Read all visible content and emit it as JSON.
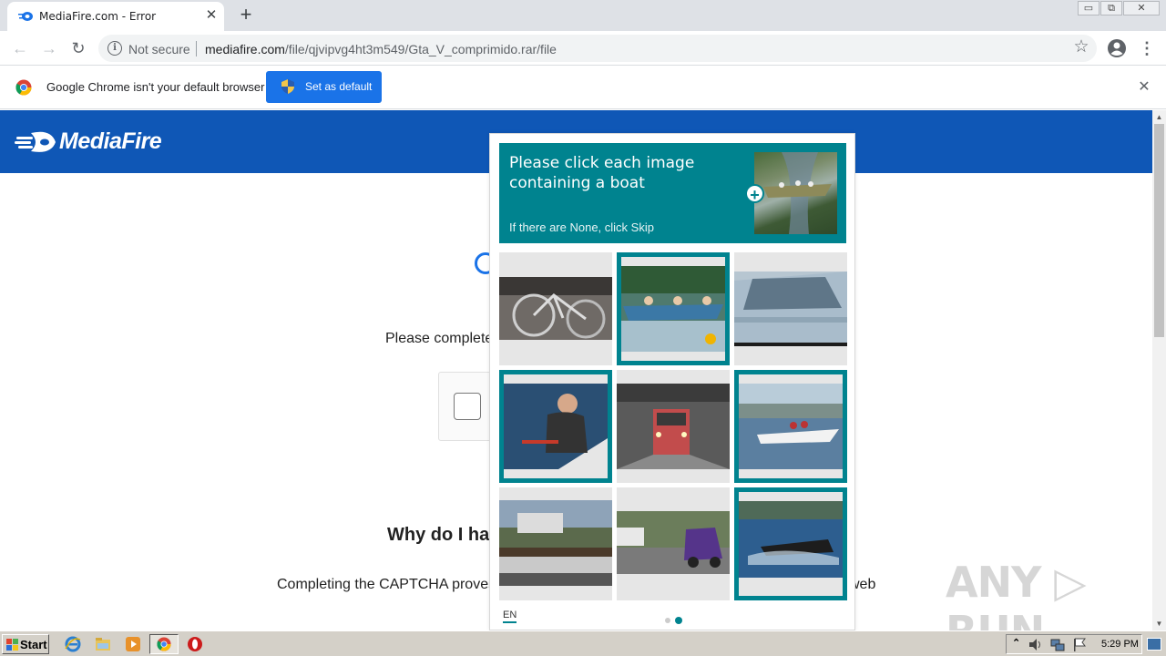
{
  "browser": {
    "tab_title": "MediaFire.com - Error",
    "tab_close": "✕",
    "new_tab": "+",
    "window_controls": {
      "minimize": "▭",
      "restore": "⧉",
      "close": "✕"
    },
    "nav": {
      "back": "←",
      "forward": "→",
      "reload": "↻",
      "menu": "⋮"
    },
    "omnibox": {
      "security_label": "Not secure",
      "url_domain": "mediafire.com",
      "url_path": "/file/qjvipvg4ht3m549/Gta_V_comprimido.rar/file",
      "star": "☆"
    }
  },
  "infobar": {
    "text": "Google Chrome isn't your default browser",
    "button_label": "Set as default",
    "close": "✕"
  },
  "page": {
    "logo_text": "MediaFire",
    "please_complete": "Please complete",
    "why_heading": "Why do I ha",
    "completing_left": "Completing the CAPTCHA proves",
    "completing_right": "web"
  },
  "scrollbar": {
    "up": "▲",
    "down": "▼"
  },
  "hcaptcha": {
    "prompt": "Please click each image containing a boat",
    "sub_prompt": "If there are None, click Skip",
    "zoom": "+",
    "language": "EN",
    "tiles": [
      {
        "name": "bicycle",
        "selected": false
      },
      {
        "name": "rowboat-people",
        "selected": true
      },
      {
        "name": "car",
        "selected": false
      },
      {
        "name": "man-in-boat",
        "selected": true
      },
      {
        "name": "train",
        "selected": false
      },
      {
        "name": "speedboat",
        "selected": true
      },
      {
        "name": "boat-house",
        "selected": false
      },
      {
        "name": "truck",
        "selected": false
      },
      {
        "name": "racing-boat",
        "selected": true
      }
    ],
    "colors": {
      "accent": "#00838f"
    }
  },
  "watermark": "ANY ▷ RUN",
  "taskbar": {
    "start_label": "Start",
    "clock": "5:29 PM",
    "tray_up": "⌃"
  }
}
